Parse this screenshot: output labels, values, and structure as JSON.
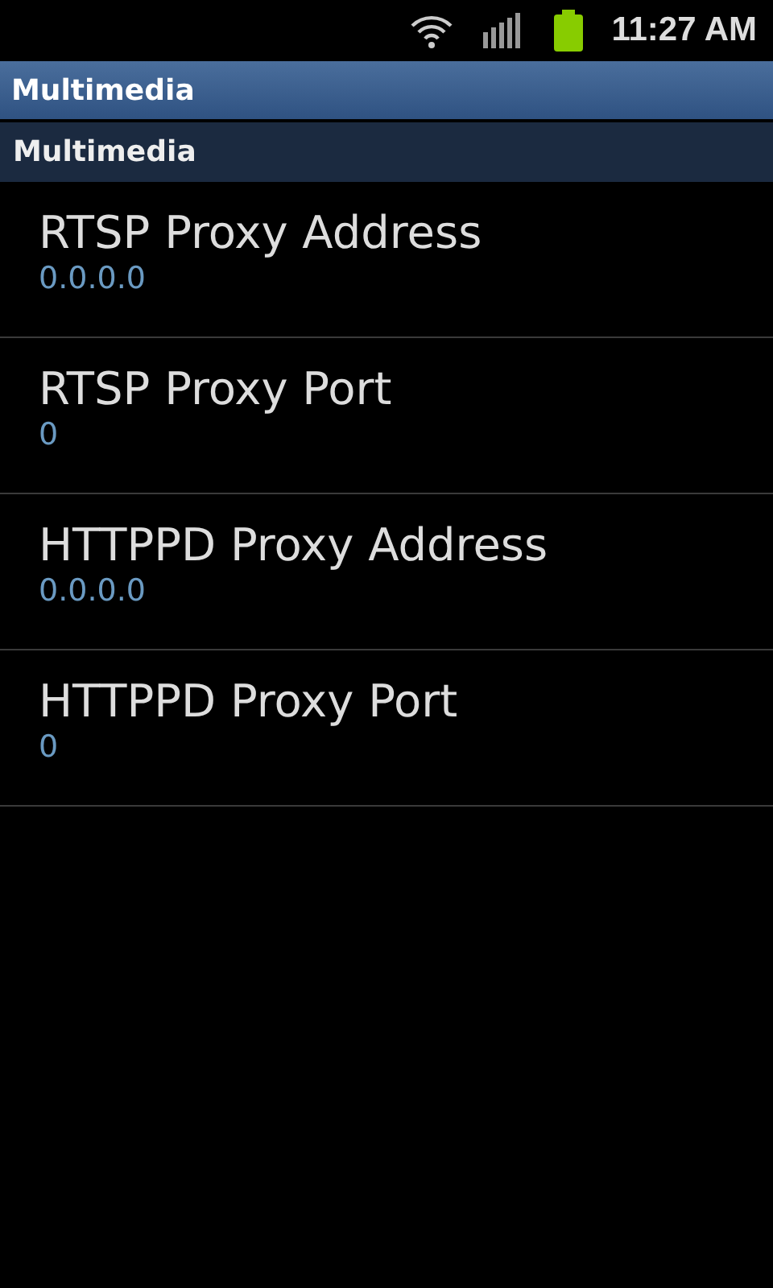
{
  "status_bar": {
    "time": "11:27 AM"
  },
  "title_bar": {
    "title": "Multimedia"
  },
  "category": {
    "title": "Multimedia"
  },
  "preferences": [
    {
      "title": "RTSP Proxy Address",
      "summary": "0.0.0.0"
    },
    {
      "title": "RTSP Proxy Port",
      "summary": "0"
    },
    {
      "title": "HTTPPD Proxy Address",
      "summary": "0.0.0.0"
    },
    {
      "title": "HTTPPD Proxy Port",
      "summary": "0"
    }
  ]
}
